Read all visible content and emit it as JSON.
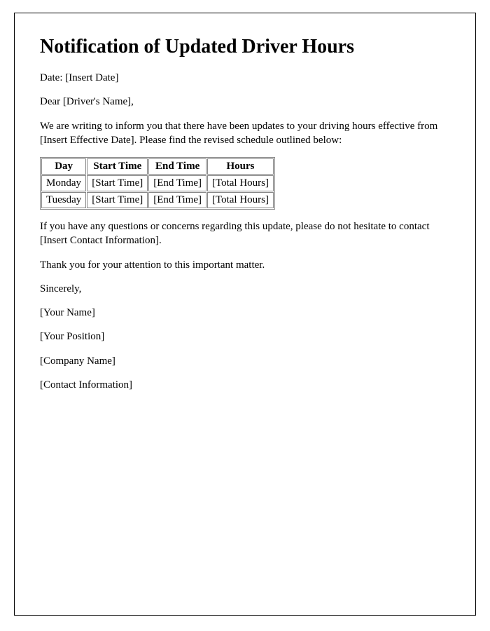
{
  "title": "Notification of Updated Driver Hours",
  "date_line": "Date: [Insert Date]",
  "salutation": "Dear [Driver's Name],",
  "intro": "We are writing to inform you that there have been updates to your driving hours effective from [Insert Effective Date]. Please find the revised schedule outlined below:",
  "table": {
    "headers": [
      "Day",
      "Start Time",
      "End Time",
      "Hours"
    ],
    "rows": [
      [
        "Monday",
        "[Start Time]",
        "[End Time]",
        "[Total Hours]"
      ],
      [
        "Tuesday",
        "[Start Time]",
        "[End Time]",
        "[Total Hours]"
      ]
    ]
  },
  "questions": "If you have any questions or concerns regarding this update, please do not hesitate to contact [Insert Contact Information].",
  "thanks": "Thank you for your attention to this important matter.",
  "closing": "Sincerely,",
  "signature": {
    "name": "[Your Name]",
    "position": "[Your Position]",
    "company": "[Company Name]",
    "contact": "[Contact Information]"
  }
}
